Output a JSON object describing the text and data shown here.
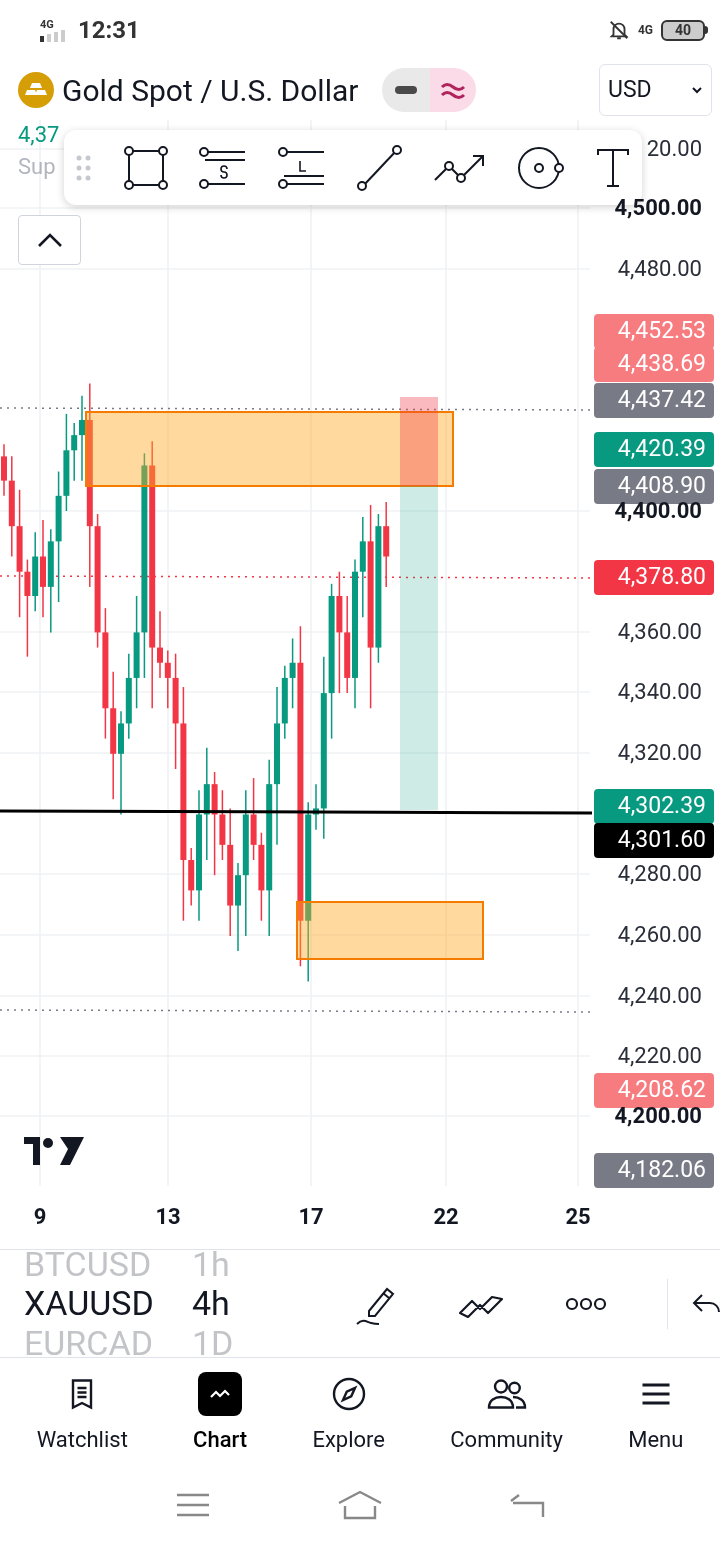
{
  "status_bar": {
    "network": "4G",
    "time": "12:31",
    "data": "4G",
    "battery": "40"
  },
  "header": {
    "title": "Gold Spot / U.S. Dollar",
    "price_partial": "4,37",
    "study_partial": "Sup",
    "currency": "USD"
  },
  "price_axis": [
    {
      "text": "20.00",
      "kind": "label"
    },
    {
      "text": "4,500.00",
      "kind": "bold"
    },
    {
      "text": "4,480.00",
      "kind": "label"
    },
    {
      "text": "4,452.53",
      "kind": "tag",
      "color": "#f77c80"
    },
    {
      "text": "4,438.69",
      "kind": "tag",
      "color": "#f77c80"
    },
    {
      "text": "4,437.42",
      "kind": "tag",
      "color": "#787b86"
    },
    {
      "text": "4,420.39",
      "kind": "tag",
      "color": "#089981"
    },
    {
      "text": "4,408.90",
      "kind": "tag",
      "color": "#787b86"
    },
    {
      "text": "4,400.00",
      "kind": "bold"
    },
    {
      "text": "4,378.80",
      "kind": "tag",
      "color": "#f23645"
    },
    {
      "text": "4,360.00",
      "kind": "label"
    },
    {
      "text": "4,340.00",
      "kind": "label"
    },
    {
      "text": "4,320.00",
      "kind": "label"
    },
    {
      "text": "4,302.39",
      "kind": "tag",
      "color": "#089981"
    },
    {
      "text": "4,301.60",
      "kind": "tag",
      "color": "#000000"
    },
    {
      "text": "4,280.00",
      "kind": "label"
    },
    {
      "text": "4,260.00",
      "kind": "label"
    },
    {
      "text": "4,240.00",
      "kind": "label"
    },
    {
      "text": "4,220.00",
      "kind": "label"
    },
    {
      "text": "4,208.62",
      "kind": "tag",
      "color": "#f77c80"
    },
    {
      "text": "4,200.00",
      "kind": "bold"
    },
    {
      "text": "4,182.06",
      "kind": "tag",
      "color": "#787b86"
    }
  ],
  "time_axis": [
    "9",
    "13",
    "17",
    "22",
    "25"
  ],
  "symbols": [
    {
      "symbol": "BTCUSD",
      "interval": "1h",
      "selected": false
    },
    {
      "symbol": "XAUUSD",
      "interval": "4h",
      "selected": true
    },
    {
      "symbol": "EURCAD",
      "interval": "1D",
      "selected": false
    }
  ],
  "nav": [
    {
      "label": "Watchlist",
      "kind": "watchlist",
      "selected": false
    },
    {
      "label": "Chart",
      "kind": "chart",
      "selected": true
    },
    {
      "label": "Explore",
      "kind": "explore",
      "selected": false
    },
    {
      "label": "Community",
      "kind": "community",
      "selected": false
    },
    {
      "label": "Menu",
      "kind": "menu",
      "selected": false
    }
  ]
}
